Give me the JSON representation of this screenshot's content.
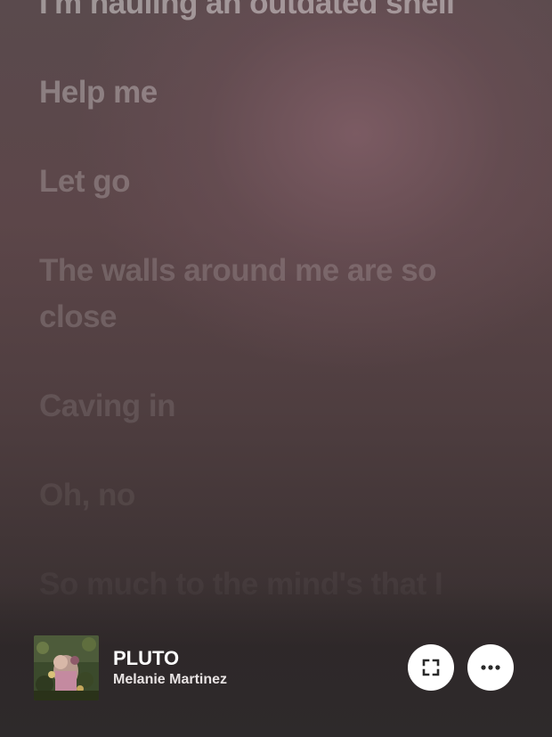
{
  "lyrics": [
    "I'm hauling an outdated shell",
    "Help me",
    "Let go",
    "The walls around me are so close",
    "Caving in",
    "Oh, no",
    "So much to the mind's that I"
  ],
  "now_playing": {
    "title": "PLUTO",
    "artist": "Melanie Martinez",
    "album_art_icon": "album-cover-art"
  },
  "controls": {
    "fullscreen_icon": "expand-icon",
    "more_icon": "more-horizontal-icon"
  },
  "colors": {
    "background_top": "#5a4a4d",
    "background_glow": "#7d5c64",
    "background_bottom": "#2f2a2b",
    "button_bg": "#ffffff",
    "icon_color": "#2a2a2a",
    "text_primary": "#ffffff"
  }
}
